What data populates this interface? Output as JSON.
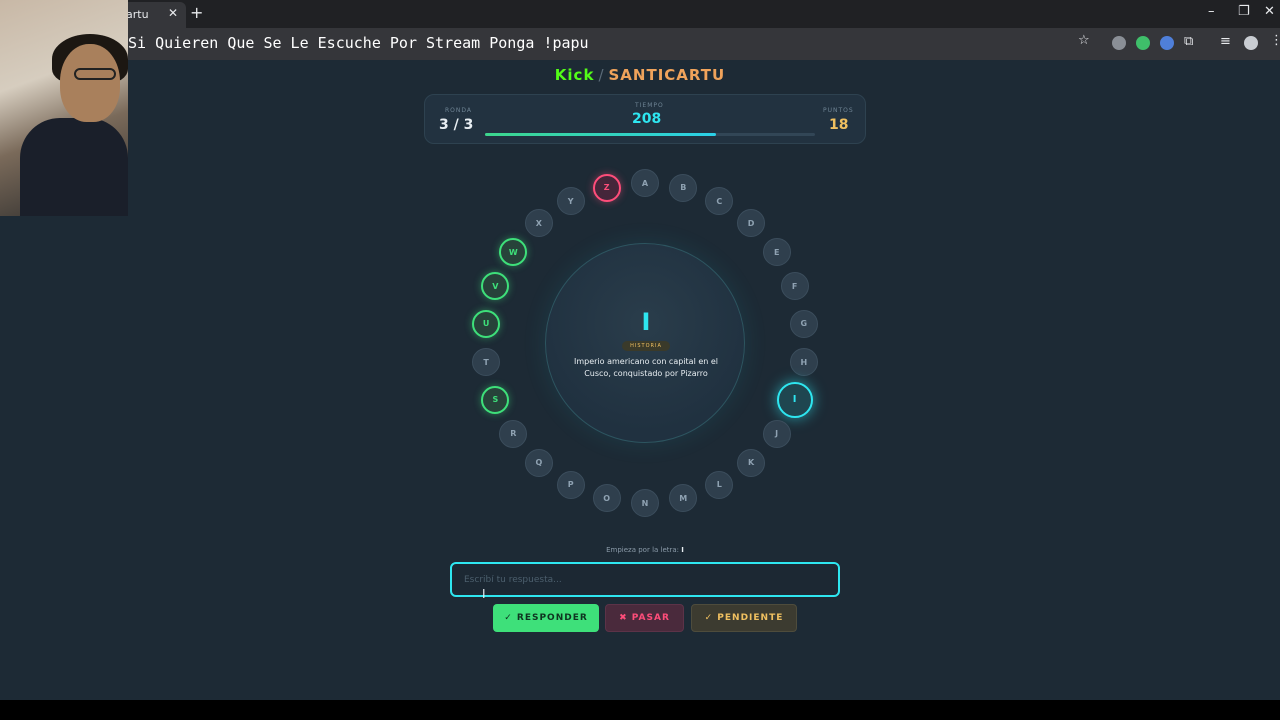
{
  "browser": {
    "tab_title": "artu",
    "tab_close": "✕",
    "new_tab": "+",
    "address_text": "Si Quieren Que Se Le Escuche Por Stream Ponga !papu",
    "window_minimize": "–",
    "window_restore": "❐",
    "window_close": "✕"
  },
  "header": {
    "platform": "Kick",
    "separator": "/",
    "channel": "SANTICARTU"
  },
  "stats": {
    "round_label": "RONDA",
    "round_value": "3 / 3",
    "time_label": "TIEMPO",
    "time_value": "208",
    "points_label": "PUNTOS",
    "points_value": "18",
    "time_progress": 0.7
  },
  "wheel": {
    "letters": [
      {
        "letter": "A",
        "state": "pending"
      },
      {
        "letter": "B",
        "state": "pending"
      },
      {
        "letter": "C",
        "state": "pending"
      },
      {
        "letter": "D",
        "state": "pending"
      },
      {
        "letter": "E",
        "state": "pending"
      },
      {
        "letter": "F",
        "state": "pending"
      },
      {
        "letter": "G",
        "state": "pending"
      },
      {
        "letter": "H",
        "state": "pending"
      },
      {
        "letter": "I",
        "state": "current"
      },
      {
        "letter": "J",
        "state": "pending"
      },
      {
        "letter": "K",
        "state": "pending"
      },
      {
        "letter": "L",
        "state": "pending"
      },
      {
        "letter": "M",
        "state": "pending"
      },
      {
        "letter": "N",
        "state": "pending"
      },
      {
        "letter": "O",
        "state": "pending"
      },
      {
        "letter": "P",
        "state": "pending"
      },
      {
        "letter": "Q",
        "state": "pending"
      },
      {
        "letter": "R",
        "state": "pending"
      },
      {
        "letter": "S",
        "state": "correct"
      },
      {
        "letter": "T",
        "state": "pending"
      },
      {
        "letter": "U",
        "state": "correct"
      },
      {
        "letter": "V",
        "state": "correct"
      },
      {
        "letter": "W",
        "state": "correct"
      },
      {
        "letter": "X",
        "state": "pending"
      },
      {
        "letter": "Y",
        "state": "pending"
      },
      {
        "letter": "Z",
        "state": "wrong"
      }
    ]
  },
  "question": {
    "letter": "I",
    "category": "HISTORIA",
    "clue": "Imperio americano con capital en el Cusco, conquistado por Pizarro"
  },
  "answer": {
    "hint_prefix": "Empieza por la letra:",
    "hint_letter": "I",
    "placeholder": "Escribí tu respuesta..."
  },
  "buttons": {
    "respond": "✓ RESPONDER",
    "skip": "✖ PASAR",
    "pending": "✓ PENDIENTE"
  },
  "colors": {
    "correct": "#3ee07a",
    "wrong": "#ff4d7a",
    "current": "#2ee6f0",
    "kick_green": "#53fc18",
    "channel_orange": "#f0a35b"
  }
}
